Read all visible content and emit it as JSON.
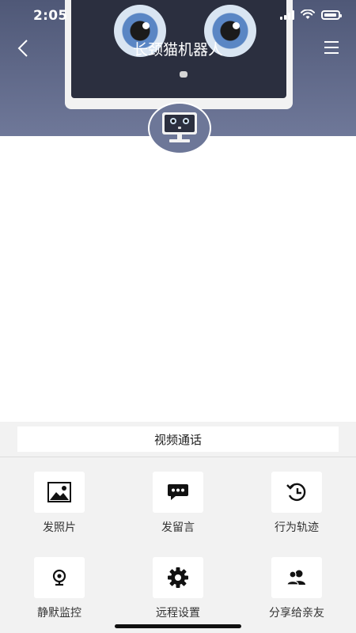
{
  "status_bar": {
    "time": "2:05"
  },
  "nav": {
    "title": "长颈猫机器人"
  },
  "actions": {
    "video_call": "视频通话",
    "items": [
      {
        "label": "发照片",
        "icon": "photo-icon"
      },
      {
        "label": "发留言",
        "icon": "message-icon"
      },
      {
        "label": "行为轨迹",
        "icon": "history-icon"
      },
      {
        "label": "静默监控",
        "icon": "webcam-icon"
      },
      {
        "label": "远程设置",
        "icon": "gear-icon"
      },
      {
        "label": "分享给亲友",
        "icon": "share-users-icon"
      }
    ]
  },
  "colors": {
    "header_bg": "#5d6687",
    "panel_bg": "#f2f2f2",
    "tile_bg": "#ffffff",
    "text": "#333333"
  }
}
